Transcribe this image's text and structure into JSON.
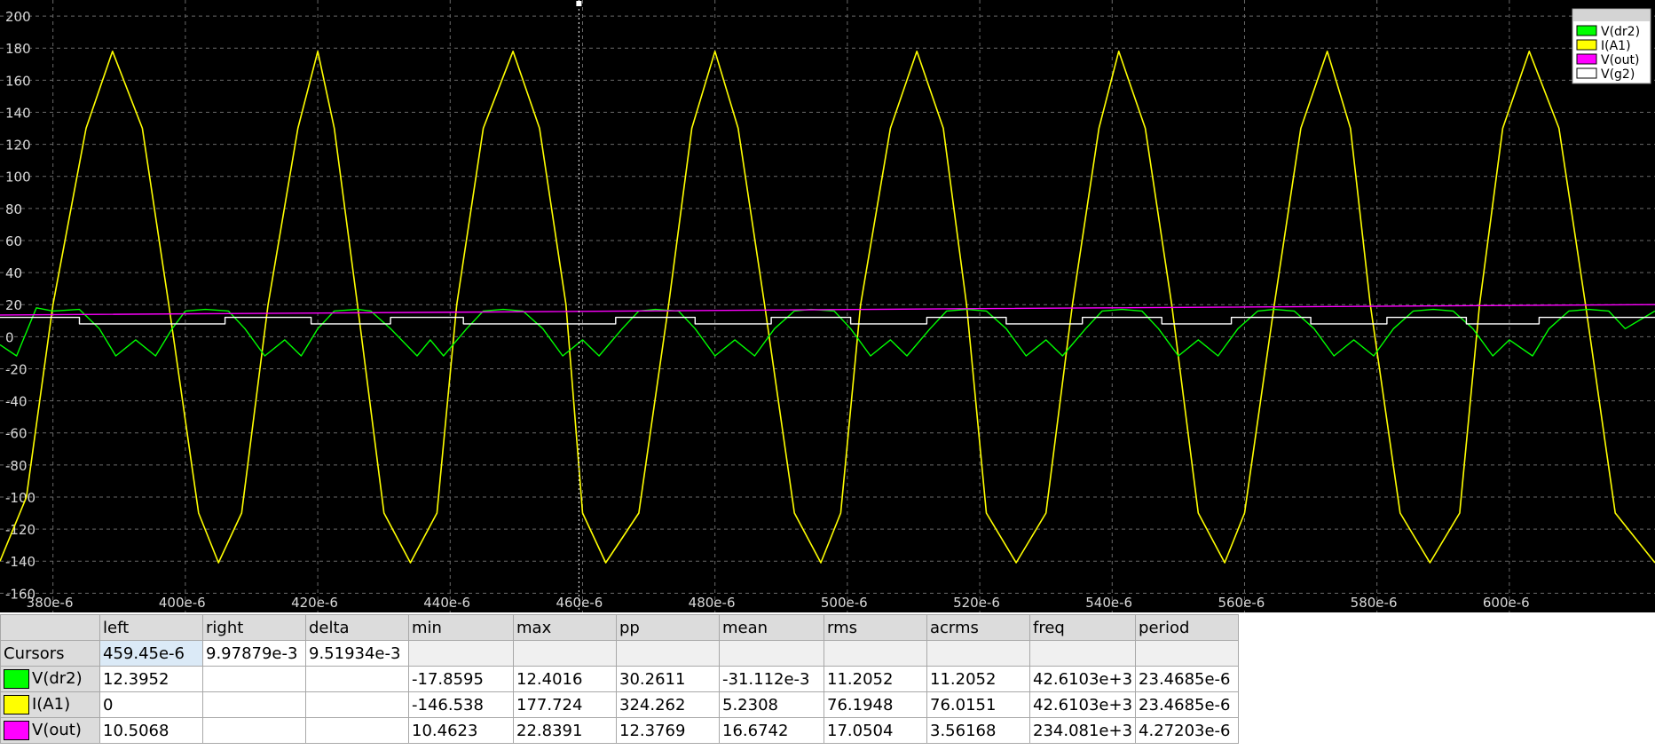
{
  "chart_data": {
    "type": "line",
    "title": "",
    "xlabel": "",
    "ylabel": "",
    "xlim": [
      0.000372,
      0.000622
    ],
    "ylim": [
      -172,
      210
    ],
    "grid": true,
    "grid_style": "dashed",
    "background": "#000000",
    "yticks": [
      200,
      180,
      160,
      140,
      120,
      100,
      80,
      60,
      40,
      20,
      0,
      -20,
      -40,
      -60,
      -80,
      -100,
      -120,
      -140,
      -160
    ],
    "xticks": [
      "380e-6",
      "400e-6",
      "420e-6",
      "440e-6",
      "460e-6",
      "480e-6",
      "500e-6",
      "520e-6",
      "540e-6",
      "560e-6",
      "580e-6",
      "600e-6"
    ],
    "xtick_values": [
      0.00038,
      0.0004,
      0.00042,
      0.00044,
      0.00046,
      0.00048,
      0.0005,
      0.00052,
      0.00054,
      0.00056,
      0.00058,
      0.0006
    ],
    "cursor_x": 0.00045945,
    "legend": {
      "placement": "top-right",
      "entries": [
        {
          "label": "V(dr2)",
          "color": "#00ff00"
        },
        {
          "label": "I(A1)",
          "color": "#ffff00"
        },
        {
          "label": "V(out)",
          "color": "#ff00ff"
        },
        {
          "label": "V(g2)",
          "color": "#ffffff"
        }
      ]
    },
    "series": [
      {
        "name": "I(A1)",
        "color": "#ffff00",
        "x": [
          0.000372,
          0.000376,
          0.00038,
          0.000385,
          0.000389,
          0.0003935,
          0.0003975,
          0.000402,
          0.000405,
          0.0004085,
          0.0004125,
          0.000417,
          0.00042,
          0.0004225,
          0.000426,
          0.00043,
          0.000434,
          0.000438,
          0.000441,
          0.000445,
          0.0004495,
          0.0004535,
          0.0004575,
          0.00046,
          0.0004635,
          0.0004685,
          0.000473,
          0.0004765,
          0.00048,
          0.0004835,
          0.0004875,
          0.000492,
          0.000496,
          0.000499,
          0.000502,
          0.0005065,
          0.0005105,
          0.0005145,
          0.000518,
          0.000521,
          0.0005255,
          0.00053,
          0.000534,
          0.000538,
          0.000541,
          0.000545,
          0.000549,
          0.000553,
          0.000557,
          0.00056,
          0.0005645,
          0.0005685,
          0.0005725,
          0.000576,
          0.000579,
          0.0005835,
          0.000588,
          0.0005925,
          0.0005955,
          0.000599,
          0.000603,
          0.0006075,
          0.0006115,
          0.000616,
          0.000622
        ],
        "y": [
          -140,
          -100,
          20,
          130,
          178,
          130,
          20,
          -110,
          -141,
          -110,
          20,
          130,
          178,
          130,
          20,
          -110,
          -141,
          -110,
          20,
          130,
          178,
          130,
          20,
          -110,
          -141,
          -110,
          20,
          130,
          178,
          130,
          20,
          -110,
          -141,
          -110,
          20,
          130,
          178,
          130,
          20,
          -110,
          -141,
          -110,
          20,
          130,
          178,
          130,
          20,
          -110,
          -141,
          -110,
          20,
          130,
          178,
          130,
          20,
          -110,
          -141,
          -110,
          20,
          130,
          178,
          130,
          20,
          -110,
          -141
        ]
      },
      {
        "name": "V(dr2)",
        "color": "#00ff00",
        "x": [
          0.000372,
          0.0003745,
          0.0003775,
          0.00038,
          0.000384,
          0.000387,
          0.0003895,
          0.0003925,
          0.0003955,
          0.000398,
          0.0004,
          0.000403,
          0.0004065,
          0.000409,
          0.000412,
          0.000415,
          0.0004175,
          0.00042,
          0.0004225,
          0.000426,
          0.000428,
          0.000431,
          0.000435,
          0.000437,
          0.000439,
          0.0004425,
          0.000445,
          0.000448,
          0.000451,
          0.000454,
          0.000457,
          0.00046,
          0.0004625,
          0.000466,
          0.0004685,
          0.000471,
          0.0004745,
          0.000477,
          0.00048,
          0.000483,
          0.000486,
          0.000489,
          0.000492,
          0.0004945,
          0.000498,
          0.0005005,
          0.0005035,
          0.0005065,
          0.000509,
          0.0005125,
          0.000515,
          0.000518,
          0.000521,
          0.000524,
          0.000527,
          0.00053,
          0.0005325,
          0.000536,
          0.0005385,
          0.0005415,
          0.0005445,
          0.000547,
          0.00055,
          0.000553,
          0.000556,
          0.000559,
          0.000562,
          0.0005645,
          0.0005675,
          0.0005705,
          0.0005735,
          0.0005765,
          0.0005795,
          0.0005825,
          0.0005855,
          0.0005885,
          0.0005915,
          0.0005945,
          0.0005975,
          0.0006,
          0.0006035,
          0.000606,
          0.000609,
          0.000612,
          0.000615,
          0.0006175,
          0.000622
        ],
        "y": [
          -5,
          -12,
          18,
          16,
          17,
          5,
          -12,
          -2,
          -12,
          5,
          16,
          17,
          16,
          5,
          -12,
          -2,
          -12,
          5,
          16,
          17,
          16,
          5,
          -12,
          -2,
          -12,
          5,
          16,
          17,
          16,
          5,
          -12,
          -2,
          -12,
          5,
          16,
          17,
          16,
          5,
          -12,
          -2,
          -12,
          5,
          16,
          17,
          16,
          5,
          -12,
          -2,
          -12,
          5,
          16,
          17,
          16,
          5,
          -12,
          -2,
          -12,
          5,
          16,
          17,
          16,
          5,
          -12,
          -2,
          -12,
          5,
          16,
          17,
          16,
          5,
          -12,
          -2,
          -12,
          5,
          16,
          17,
          16,
          5,
          -12,
          -2,
          -12,
          5,
          16,
          17,
          16,
          5,
          16
        ]
      },
      {
        "name": "V(out)",
        "color": "#ff00ff",
        "x": [
          0.000372,
          0.00045,
          0.00052,
          0.000622
        ],
        "y": [
          13.5,
          15.5,
          17.5,
          20
        ]
      },
      {
        "name": "V(g2)",
        "color": "#ffffff",
        "x": [
          0.000372,
          0.000384,
          0.000384,
          0.000406,
          0.000406,
          0.000419,
          0.000419,
          0.000431,
          0.000431,
          0.000442,
          0.000442,
          0.000465,
          0.000465,
          0.000477,
          0.000477,
          0.0004885,
          0.0004885,
          0.0005005,
          0.0005005,
          0.000512,
          0.000512,
          0.000524,
          0.000524,
          0.0005355,
          0.0005355,
          0.0005475,
          0.0005475,
          0.000558,
          0.000558,
          0.00057,
          0.00057,
          0.0005815,
          0.0005815,
          0.0005935,
          0.0005935,
          0.0006045,
          0.0006045,
          0.000622
        ],
        "y": [
          12,
          12,
          8,
          8,
          12,
          12,
          8,
          8,
          12,
          12,
          8,
          8,
          12,
          12,
          8,
          8,
          12,
          12,
          8,
          8,
          12,
          12,
          8,
          8,
          12,
          12,
          8,
          8,
          12,
          12,
          8,
          8,
          12,
          12,
          8,
          8,
          12,
          12
        ]
      }
    ]
  },
  "table": {
    "headers": [
      "",
      "left",
      "right",
      "delta",
      "min",
      "max",
      "pp",
      "mean",
      "rms",
      "acrms",
      "freq",
      "period"
    ],
    "cursors_row": [
      "Cursors",
      "459.45e-6",
      "9.97879e-3",
      "9.51934e-3"
    ],
    "rows": [
      {
        "label": "V(dr2)",
        "color": "#00ff00",
        "values": [
          "12.3952",
          "",
          "",
          "-17.8595",
          "12.4016",
          "30.2611",
          "-31.112e-3",
          "11.2052",
          "11.2052",
          "42.6103e+3",
          "23.4685e-6"
        ]
      },
      {
        "label": "I(A1)",
        "color": "#ffff00",
        "values": [
          "0",
          "",
          "",
          "-146.538",
          "177.724",
          "324.262",
          "5.2308",
          "76.1948",
          "76.0151",
          "42.6103e+3",
          "23.4685e-6"
        ]
      },
      {
        "label": "V(out)",
        "color": "#ff00ff",
        "values": [
          "10.5068",
          "",
          "",
          "10.4623",
          "22.8391",
          "12.3769",
          "16.6742",
          "17.0504",
          "3.56168",
          "234.081e+3",
          "4.27203e-6"
        ]
      }
    ]
  }
}
